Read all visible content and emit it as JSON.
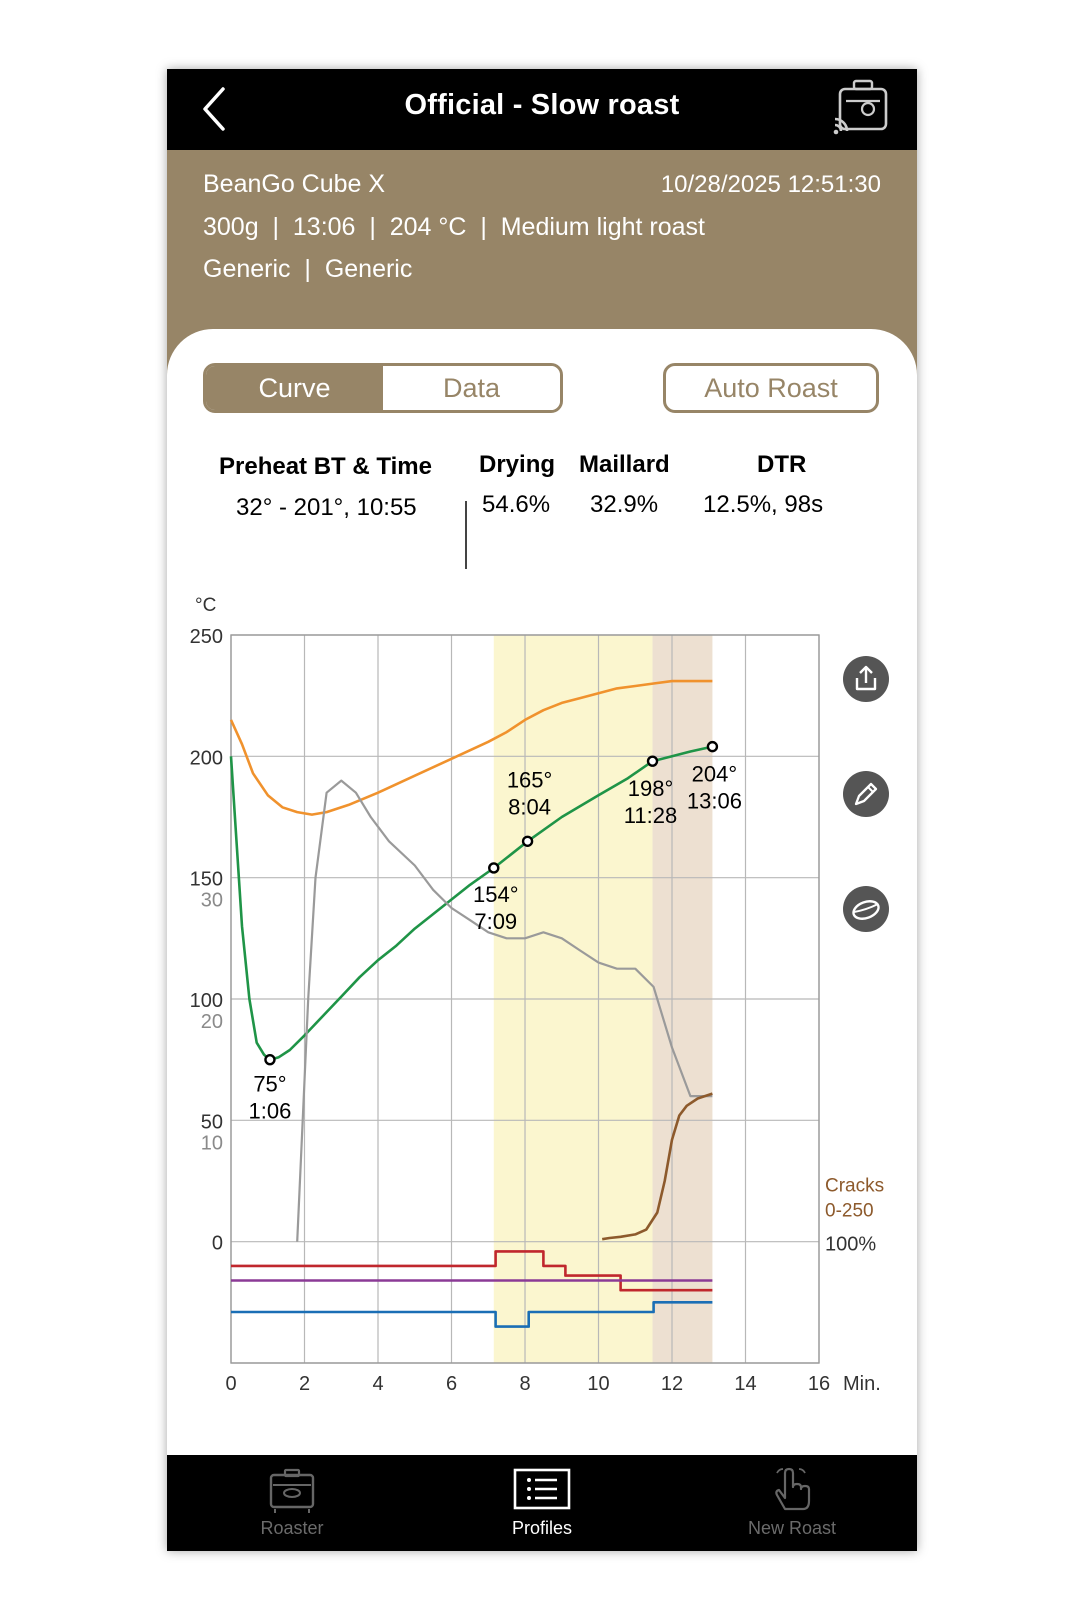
{
  "header": {
    "title": "Official - Slow roast"
  },
  "roast_info": {
    "roaster": "BeanGo Cube X",
    "datetime": "10/28/2025 12:51:30",
    "details": "300g  |  13:06  |  204 °C  |  Medium light roast",
    "origin": "Generic  |  Generic"
  },
  "tabs": {
    "curve": "Curve",
    "data": "Data"
  },
  "auto_roast": "Auto Roast",
  "stats": {
    "preheat_label": "Preheat BT & Time",
    "preheat_value": "32° - 201°, 10:55",
    "drying_label": "Drying",
    "drying_value": "54.6%",
    "maillard_label": "Maillard",
    "maillard_value": "32.9%",
    "dtr_label": "DTR",
    "dtr_value": "12.5%, 98s"
  },
  "chart_data": {
    "type": "line",
    "y_unit": "°C",
    "x_unit": "Min.",
    "xlim": [
      0,
      16
    ],
    "ylim": [
      -50,
      250
    ],
    "xticks": [
      0,
      2,
      4,
      6,
      8,
      10,
      12,
      14,
      16
    ],
    "yticks": [
      0,
      50,
      100,
      150,
      200,
      250
    ],
    "ror_ticks": [
      10,
      20,
      30
    ],
    "grid": true,
    "phases": [
      {
        "name": "maillard",
        "start": 7.15,
        "end": 11.47,
        "color": "#fbf6cf"
      },
      {
        "name": "development",
        "start": 11.47,
        "end": 13.1,
        "color": "#ede0d1"
      }
    ],
    "cracks_label": [
      "Cracks",
      "0-250"
    ],
    "cracks_pct_label": "100%",
    "series": [
      {
        "key": "et",
        "color": "#f0922d",
        "x": [
          0,
          0.3,
          0.6,
          1.0,
          1.4,
          1.8,
          2.2,
          2.6,
          3.2,
          4,
          5,
          6,
          7,
          7.5,
          8,
          8.5,
          9,
          9.5,
          10,
          10.5,
          11,
          11.5,
          12,
          12.5,
          13.1
        ],
        "y": [
          215,
          205,
          193,
          184,
          179,
          177,
          176,
          177,
          180,
          185,
          192,
          199,
          206,
          210,
          215,
          219,
          222,
          224,
          226,
          228,
          229,
          230,
          231,
          231,
          231
        ]
      },
      {
        "key": "bt",
        "color": "#1f9447",
        "x": [
          0,
          0.15,
          0.3,
          0.5,
          0.7,
          0.9,
          1.06,
          1.3,
          1.6,
          2,
          2.5,
          3,
          3.5,
          4,
          4.5,
          5,
          5.5,
          6,
          6.5,
          7.15,
          8.07,
          9,
          10,
          10.8,
          11.47,
          12,
          12.5,
          13.1
        ],
        "y": [
          200,
          165,
          130,
          100,
          82,
          77,
          75,
          76,
          79,
          85,
          93,
          101,
          109,
          116,
          122,
          129,
          135,
          141,
          147,
          154,
          165,
          175,
          184,
          191,
          198,
          200,
          202,
          204
        ]
      },
      {
        "key": "ror",
        "color": "#9a9a9a",
        "x": [
          1.8,
          1.95,
          2.1,
          2.3,
          2.6,
          3.0,
          3.4,
          3.8,
          4.3,
          5,
          5.5,
          6,
          6.5,
          7,
          7.5,
          8,
          8.5,
          9,
          9.5,
          10,
          10.5,
          11,
          11.5,
          12,
          12.5,
          13.1
        ],
        "y": [
          0,
          10,
          20,
          30,
          37,
          38,
          37,
          35,
          33,
          31,
          29,
          27.5,
          26.5,
          25.5,
          25,
          25,
          25.5,
          25,
          24,
          23,
          22.5,
          22.5,
          21,
          16,
          12,
          12
        ]
      },
      {
        "key": "cracks",
        "color": "#8d5a2c",
        "x": [
          10.1,
          10.3,
          10.6,
          11.0,
          11.3,
          11.6,
          11.8,
          12.0,
          12.2,
          12.4,
          12.7,
          13.1
        ],
        "y": [
          1,
          1.5,
          2,
          3,
          5,
          12,
          25,
          42,
          52,
          56,
          59,
          61
        ]
      },
      {
        "key": "heater",
        "color": "#c0272d",
        "x": [
          0,
          7.2,
          7.2,
          8.5,
          8.5,
          9.1,
          9.1,
          10.6,
          10.6,
          13.1
        ],
        "y": [
          -10,
          -10,
          -4,
          -4,
          -10,
          -10,
          -14,
          -14,
          -20,
          -20
        ]
      },
      {
        "key": "fan",
        "color": "#8b3a96",
        "x": [
          0,
          13.1
        ],
        "y": [
          -16,
          -16
        ]
      },
      {
        "key": "drum",
        "color": "#1a6eb5",
        "x": [
          0,
          7.2,
          7.2,
          8.1,
          8.1,
          11.5,
          11.5,
          13.1
        ],
        "y": [
          -29,
          -29,
          -35,
          -35,
          -29,
          -29,
          -25,
          -25
        ]
      }
    ],
    "events": [
      {
        "x": 1.06,
        "y": 75,
        "temp": "75°",
        "time": "1:06"
      },
      {
        "x": 7.15,
        "y": 154,
        "temp": "154°",
        "time": "7:09"
      },
      {
        "x": 8.07,
        "y": 165,
        "temp": "165°",
        "time": "8:04"
      },
      {
        "x": 11.47,
        "y": 198,
        "temp": "198°",
        "time": "11:28"
      },
      {
        "x": 13.1,
        "y": 204,
        "temp": "204°",
        "time": "13:06"
      }
    ]
  },
  "side_actions": [
    "share-icon",
    "edit-icon",
    "bean-icon"
  ],
  "bottom_nav": [
    {
      "label": "Roaster",
      "icon": "roaster-icon",
      "active": false
    },
    {
      "label": "Profiles",
      "icon": "list-icon",
      "active": true
    },
    {
      "label": "New Roast",
      "icon": "hand-icon",
      "active": false
    }
  ],
  "colors": {
    "accent": "#978567",
    "bar": "#000000",
    "inactive_nav": "#6b6b6b"
  }
}
